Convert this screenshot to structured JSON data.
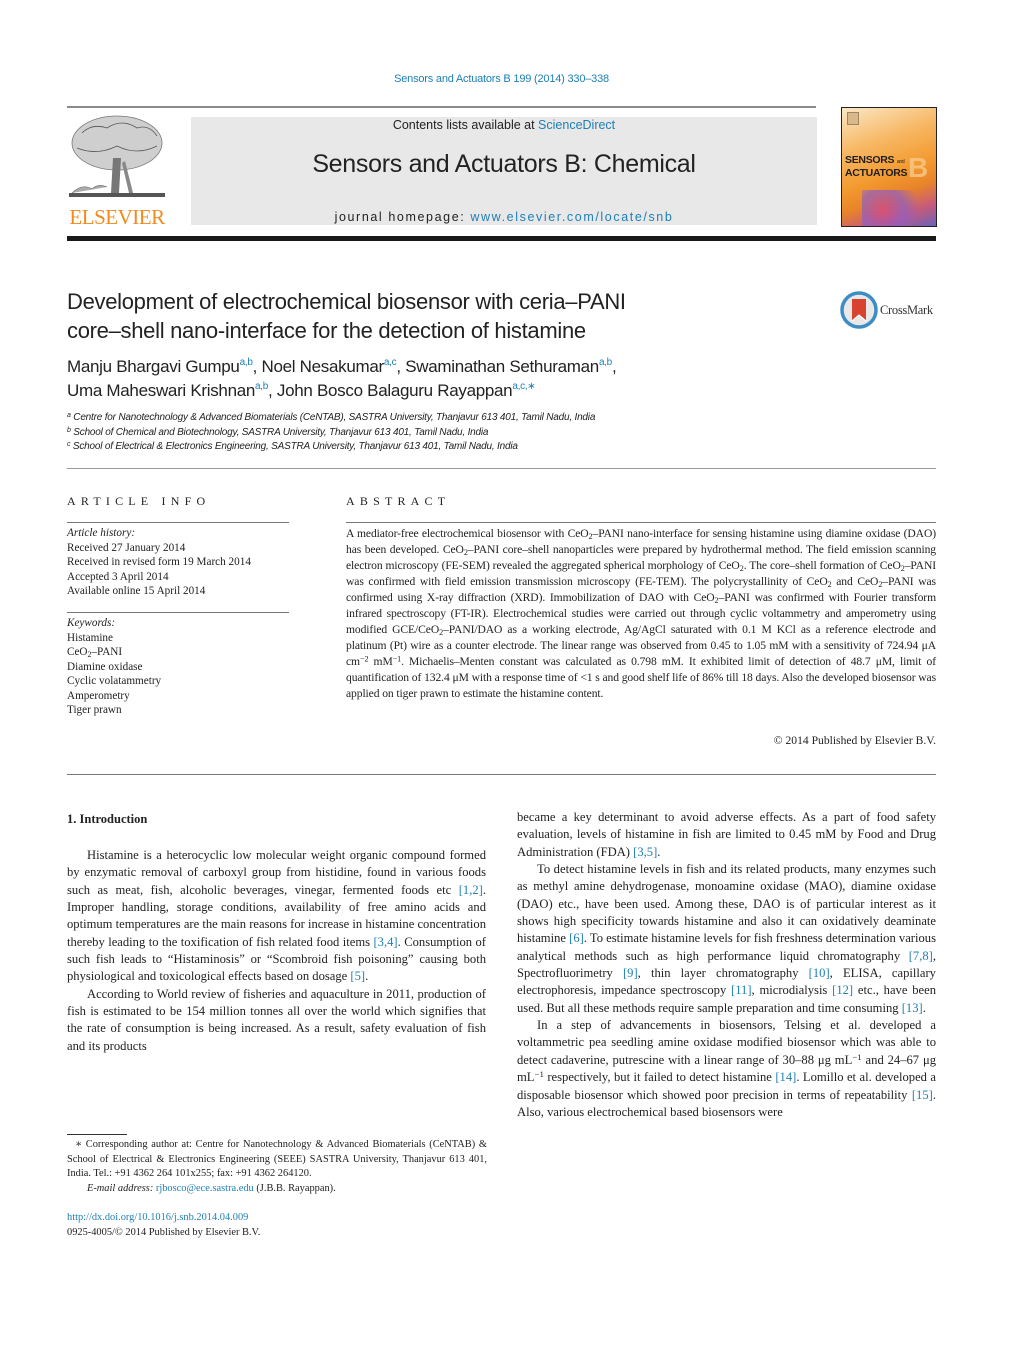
{
  "header": {
    "journal_ref": "Sensors and Actuators B 199 (2014) 330–338",
    "contents_prefix": "Contents lists available at ",
    "contents_link": "ScienceDirect",
    "journal_title": "Sensors and Actuators B: Chemical",
    "homepage_prefix": "journal homepage: ",
    "homepage_link": "www.elsevier.com/locate/snb",
    "publisher_logo_text": "ELSEVIER",
    "cover": {
      "line1": "SENSORS",
      "and": "and",
      "line2": "ACTUATORS",
      "letter": "B"
    },
    "crossmark_label": "CrossMark",
    "colors": {
      "link": "#1f7fb5",
      "elsevier_orange": "#f28a1e",
      "banner_gray": "#e8e8e8"
    }
  },
  "article": {
    "title_line1": "Development of electrochemical biosensor with ceria–PANI",
    "title_line2": "core–shell nano-interface for the detection of histamine",
    "authors": [
      {
        "name": "Manju Bhargavi Gumpu",
        "affil": "a,b",
        "sep": ", "
      },
      {
        "name": "Noel Nesakumar",
        "affil": "a,c",
        "sep": ", "
      },
      {
        "name": "Swaminathan Sethuraman",
        "affil": "a,b",
        "sep": ","
      },
      {
        "name": "Uma Maheswari Krishnan",
        "affil": "a,b",
        "sep": ", "
      },
      {
        "name": "John Bosco Balaguru Rayappan",
        "affil": "a,c,∗",
        "sep": ""
      }
    ],
    "affiliations": [
      {
        "key": "a",
        "text": "Centre for Nanotechnology & Advanced Biomaterials (CeNTAB), SASTRA University, Thanjavur 613 401, Tamil Nadu, India"
      },
      {
        "key": "b",
        "text": "School of Chemical and Biotechnology, SASTRA University, Thanjavur 613 401, Tamil Nadu, India"
      },
      {
        "key": "c",
        "text": "School of Electrical & Electronics Engineering, SASTRA University, Thanjavur 613 401, Tamil Nadu, India"
      }
    ]
  },
  "article_info": {
    "heading": "ARTICLE INFO",
    "history_label": "Article history:",
    "history": [
      "Received 27 January 2014",
      "Received in revised form 19 March 2014",
      "Accepted 3 April 2014",
      "Available online 15 April 2014"
    ],
    "keywords_label": "Keywords:",
    "keywords": [
      "Histamine",
      "CeO2–PANI",
      "Diamine oxidase",
      "Cyclic volatammetry",
      "Amperometry",
      "Tiger prawn"
    ]
  },
  "abstract": {
    "heading": "ABSTRACT",
    "parts": {
      "p1": "A mediator-free electrochemical biosensor with CeO",
      "p2": "–PANI nano-interface for sensing histamine using diamine oxidase (DAO) has been developed. CeO",
      "p3": "–PANI core–shell nanoparticles were prepared by hydrothermal method. The field emission scanning electron microscopy (FE-SEM) revealed the aggregated spherical morphology of CeO",
      "p4": ". The core–shell formation of CeO",
      "p5": "–PANI was confirmed with field emission transmission microscopy (FE-TEM). The polycrystallinity of CeO",
      "p6": " and CeO",
      "p7": "–PANI was confirmed using X-ray diffraction (XRD). Immobilization of DAO with CeO",
      "p8": "–PANI was confirmed with Fourier transform infrared spectroscopy (FT-IR). Electrochemical studies were carried out through cyclic voltammetry and amperometry using modified GCE/CeO",
      "p9": "–PANI/DAO as a working electrode, Ag/AgCl saturated with 0.1 M KCl as a reference electrode and platinum (Pt) wire as a counter electrode. The linear range was observed from 0.45 to 1.05 mM with a sensitivity of 724.94 μA cm",
      "exp1": "−2",
      "p10": " mM",
      "exp2": "−1",
      "p11": ". Michaelis–Menten constant was calculated as 0.798 mM. It exhibited limit of detection of 48.7 μM, limit of quantification of 132.4 μM with a response time of <1 s and good shelf life of 86% till 18 days. Also the developed biosensor was applied on tiger prawn to estimate the histamine content.",
      "sub2": "2"
    },
    "copyright": "© 2014 Published by Elsevier B.V."
  },
  "introduction": {
    "heading": "1.  Introduction",
    "left": {
      "para1_a": "Histamine is a heterocyclic low molecular weight organic compound formed by enzymatic removal of carboxyl group from histidine, found in various foods such as meat, fish, alcoholic beverages, vinegar, fermented foods etc ",
      "ref1": "[1,2]",
      "para1_b": ". Improper handling, storage conditions, availability of free amino acids and optimum temperatures are the main reasons for increase in histamine concentration thereby leading to the toxification of fish related food items ",
      "ref2": "[3,4]",
      "para1_c": ". Consumption of such fish leads to “Histaminosis” or “Scombroid fish poisoning” causing both physiological and toxicological effects based on dosage ",
      "ref3": "[5]",
      "para1_d": ".",
      "para2": "According to World review of fisheries and aquaculture in 2011, production of fish is estimated to be 154 million tonnes all over the world which signifies that the rate of consumption is being increased. As a result, safety evaluation of fish and its products"
    },
    "right": {
      "para0_a": "became a key determinant to avoid adverse effects. As a part of food safety evaluation, levels of histamine in fish are limited to 0.45 mM by Food and Drug Administration (FDA) ",
      "ref_a": "[3,5]",
      "para0_b": ".",
      "para1_a": "To detect histamine levels in fish and its related products, many enzymes such as methyl amine dehydrogenase, monoamine oxidase (MAO), diamine oxidase (DAO) etc., have been used. Among these, DAO is of particular interest as it shows high specificity towards histamine and also it can oxidatively deaminate histamine ",
      "ref6": "[6]",
      "para1_b": ". To estimate histamine levels for fish freshness determination various analytical methods such as high performance liquid chromatography ",
      "ref78": "[7,8]",
      "para1_c": ", Spectrofluorimetry ",
      "ref9": "[9]",
      "para1_d": ", thin layer chromatography ",
      "ref10": "[10]",
      "para1_e": ", ELISA, capillary electrophoresis, impedance spectroscopy ",
      "ref11": "[11]",
      "para1_f": ", microdialysis ",
      "ref12": "[12]",
      "para1_g": " etc., have been used. But all these methods require sample preparation and time consuming ",
      "ref13": "[13]",
      "para1_h": ".",
      "para2_a": "In a step of advancements in biosensors, Telsing et al. developed a voltammetric pea seedling amine oxidase modified biosensor which was able to detect cadaverine, putrescine with a linear range of 30–88 μg mL",
      "exp": "−1",
      "para2_b": " and 24–67 μg mL",
      "para2_c": " respectively, but it failed to detect histamine ",
      "ref14": "[14]",
      "para2_d": ". Lomillo et al. developed a disposable biosensor which showed poor precision in terms of repeatability ",
      "ref15": "[15]",
      "para2_e": ". Also, various electrochemical based biosensors were"
    }
  },
  "footnote": {
    "corresponding": "∗  Corresponding author at: Centre for Nanotechnology & Advanced Biomaterials (CeNTAB) & School of Electrical & Electronics Engineering (SEEE) SASTRA University, Thanjavur 613 401, India. Tel.: +91 4362 264 101x255; fax: +91 4362 264120.",
    "email_label": "E-mail address: ",
    "email": "rjbosco@ece.sastra.edu",
    "email_suffix": " (J.B.B. Rayappan).",
    "doi": "http://dx.doi.org/10.1016/j.snb.2014.04.009",
    "issn": "0925-4005/© 2014 Published by Elsevier B.V."
  }
}
